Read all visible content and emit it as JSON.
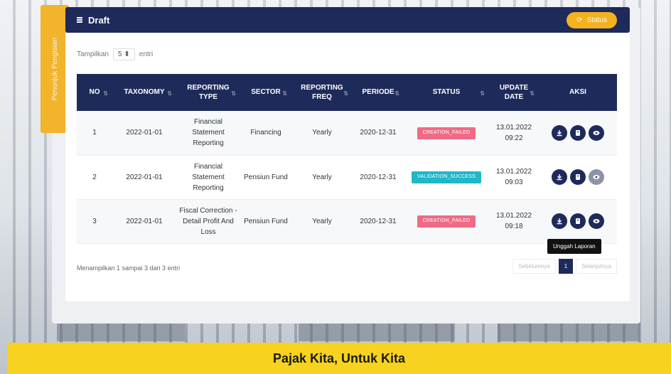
{
  "side_tab": {
    "label": "Penunjuk Pengisian"
  },
  "header": {
    "title": "Draft",
    "button_label": "Status"
  },
  "show_entries": {
    "prefix": "Tampilkan",
    "value": "5",
    "suffix": "entri"
  },
  "table": {
    "columns": [
      "NO",
      "TAXONOMY",
      "REPORTING TYPE",
      "SECTOR",
      "REPORTING FREQ",
      "PERIODE",
      "STATUS",
      "UPDATE DATE",
      "AKSI"
    ],
    "rows": [
      {
        "no": "1",
        "taxonomy": "2022-01-01",
        "reporting_type": "Financial Statement Reporting",
        "sector": "Financing",
        "freq": "Yearly",
        "periode": "2020-12-31",
        "status": "CREATION_FAILED",
        "status_color": "#f06a85",
        "date": "13.01.2022",
        "time": "09:22"
      },
      {
        "no": "2",
        "taxonomy": "2022-01-01",
        "reporting_type": "Financial Statement Reporting",
        "sector": "Pensiun Fund",
        "freq": "Yearly",
        "periode": "2020-12-31",
        "status": "VALIDATION_SUCCESS",
        "status_color": "#1eb8c9",
        "date": "13.01.2022",
        "time": "09:03"
      },
      {
        "no": "3",
        "taxonomy": "2022-01-01",
        "reporting_type": "Fiscal Correction - Detail Profit And Loss",
        "sector": "Pensiun Fund",
        "freq": "Yearly",
        "periode": "2020-12-31",
        "status": "CREATION_FAILED",
        "status_color": "#f06a85",
        "date": "13.01.2022",
        "time": "09:18"
      }
    ]
  },
  "tooltip": "Unggah Laporan",
  "footer_info": "Menampilkan 1 sampai 3 dari 3 entri",
  "pager": {
    "prev": "Sebelumnya",
    "page": "1",
    "next": "Selanjutnya"
  },
  "bottom_banner": "Pajak Kita, Untuk Kita",
  "colors": {
    "navy": "#1e2a5a",
    "accent": "#f5b21f",
    "banner": "#f7d21e"
  }
}
